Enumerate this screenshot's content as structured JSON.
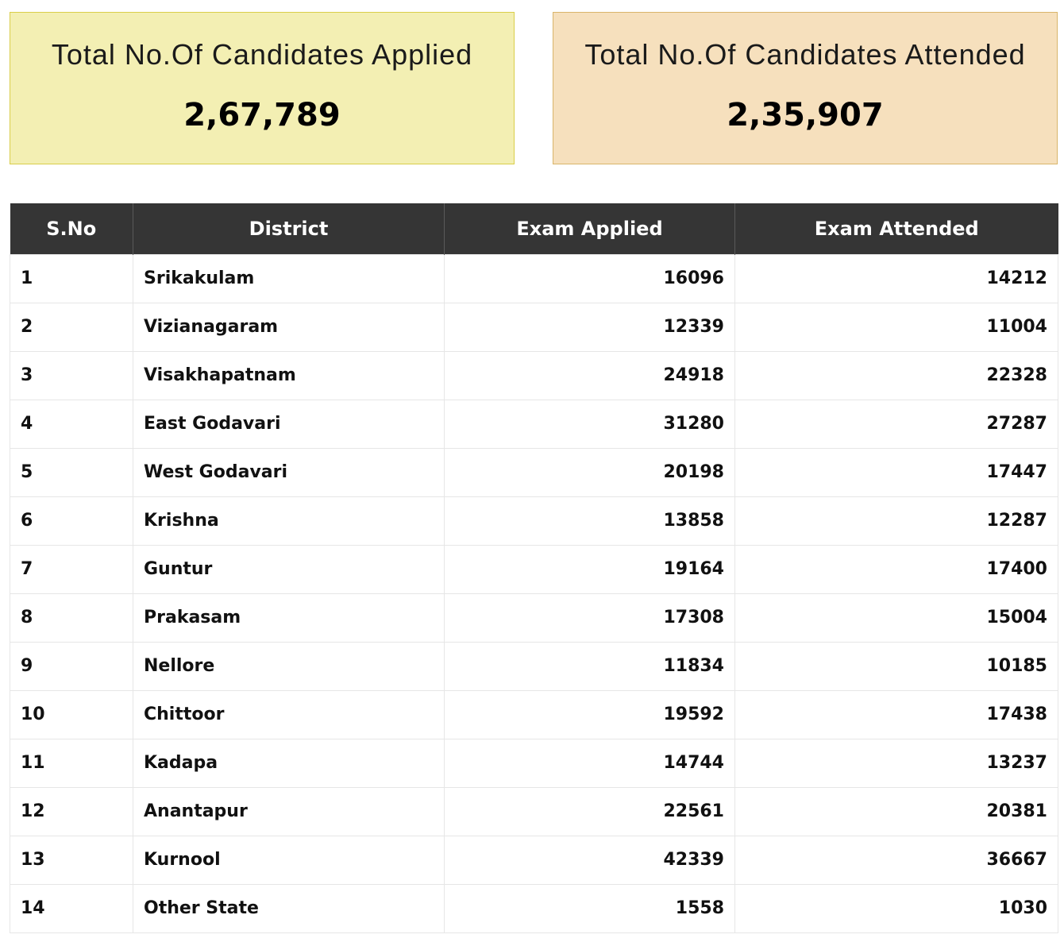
{
  "summary": {
    "applied_label": "Total No.Of Candidates Applied",
    "applied_value": "2,67,789",
    "attended_label": "Total No.Of Candidates Attended",
    "attended_value": "2,35,907"
  },
  "colors": {
    "applied_card_bg": "#f3efb3",
    "attended_card_bg": "#f6e0bd",
    "table_header_bg": "#353535"
  },
  "table": {
    "headers": [
      "S.No",
      "District",
      "Exam Applied",
      "Exam Attended"
    ],
    "rows": [
      {
        "sno": "1",
        "district": "Srikakulam",
        "applied": "16096",
        "attended": "14212"
      },
      {
        "sno": "2",
        "district": "Vizianagaram",
        "applied": "12339",
        "attended": "11004"
      },
      {
        "sno": "3",
        "district": "Visakhapatnam",
        "applied": "24918",
        "attended": "22328"
      },
      {
        "sno": "4",
        "district": "East Godavari",
        "applied": "31280",
        "attended": "27287"
      },
      {
        "sno": "5",
        "district": "West Godavari",
        "applied": "20198",
        "attended": "17447"
      },
      {
        "sno": "6",
        "district": "Krishna",
        "applied": "13858",
        "attended": "12287"
      },
      {
        "sno": "7",
        "district": "Guntur",
        "applied": "19164",
        "attended": "17400"
      },
      {
        "sno": "8",
        "district": "Prakasam",
        "applied": "17308",
        "attended": "15004"
      },
      {
        "sno": "9",
        "district": "Nellore",
        "applied": "11834",
        "attended": "10185"
      },
      {
        "sno": "10",
        "district": "Chittoor",
        "applied": "19592",
        "attended": "17438"
      },
      {
        "sno": "11",
        "district": "Kadapa",
        "applied": "14744",
        "attended": "13237"
      },
      {
        "sno": "12",
        "district": "Anantapur",
        "applied": "22561",
        "attended": "20381"
      },
      {
        "sno": "13",
        "district": "Kurnool",
        "applied": "42339",
        "attended": "36667"
      },
      {
        "sno": "14",
        "district": "Other State",
        "applied": "1558",
        "attended": "1030"
      }
    ]
  }
}
